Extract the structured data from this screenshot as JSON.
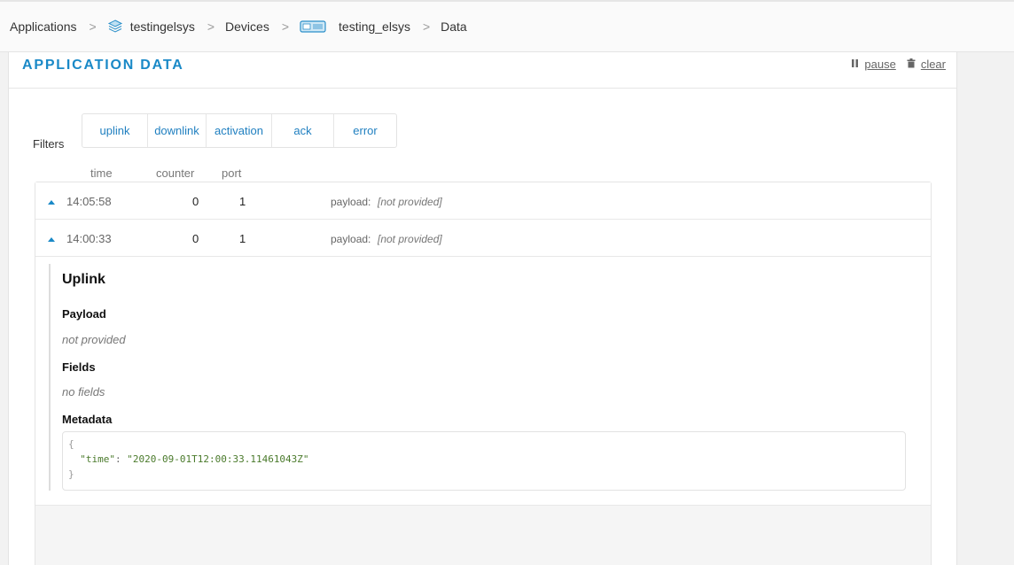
{
  "breadcrumb": {
    "applications": "Applications",
    "app_name": "testingelsys",
    "devices": "Devices",
    "device_name": "testing_elsys",
    "data": "Data",
    "separator": ">"
  },
  "panel": {
    "title": "APPLICATION DATA",
    "pause_label": "pause",
    "clear_label": "clear"
  },
  "filters": {
    "label": "Filters",
    "buttons": [
      "uplink",
      "downlink",
      "activation",
      "ack",
      "error"
    ]
  },
  "columns": {
    "time": "time",
    "counter": "counter",
    "port": "port"
  },
  "rows": [
    {
      "time": "14:05:58",
      "counter": "0",
      "port": "1",
      "payload_label": "payload:",
      "payload_value": "[not provided]"
    },
    {
      "time": "14:00:33",
      "counter": "0",
      "port": "1",
      "payload_label": "payload:",
      "payload_value": "[not provided]"
    }
  ],
  "detail": {
    "title": "Uplink",
    "payload_heading": "Payload",
    "payload_value": "not provided",
    "fields_heading": "Fields",
    "fields_value": "no fields",
    "metadata_heading": "Metadata",
    "metadata_open": "{",
    "metadata_key": "\"time\"",
    "metadata_colon": ": ",
    "metadata_value": "\"2020-09-01T12:00:33.11461043Z\"",
    "metadata_close": "}"
  },
  "colors": {
    "accent": "#1a89c7",
    "link": "#1f7fc0",
    "json_string": "#4a7a2b"
  },
  "icons": {
    "app": "layers-icon",
    "device": "device-icon",
    "pause": "pause-icon",
    "clear": "trash-icon",
    "expand": "caret-up-icon"
  }
}
